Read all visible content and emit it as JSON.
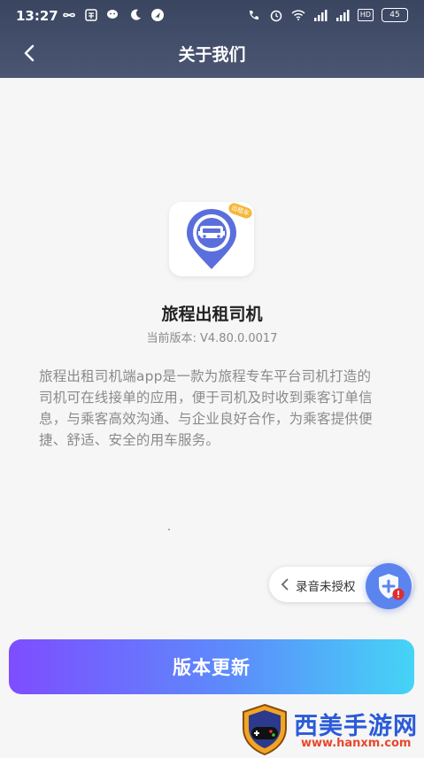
{
  "status_bar": {
    "time": "13:27",
    "battery": "45",
    "hd_badge": "HD",
    "network_label": "4G"
  },
  "nav": {
    "title": "关于我们"
  },
  "app": {
    "tag": "出租车",
    "name": "旅程出租司机",
    "version": "当前版本: V4.80.0.0017",
    "description": "旅程出租司机端app是一款为旅程专车平台司机打造的司机可在线接单的应用，便于司机及时收到乘客订单信息，与乘客高效沟通、与企业良好合作，为乘客提供便捷、舒适、安全的用车服务。"
  },
  "permission": {
    "label": "录音未授权"
  },
  "update_button": {
    "label": "版本更新"
  },
  "watermark": {
    "title": "西美手游网",
    "url": "www.hanxm.com"
  },
  "colors": {
    "header_bg": "#3a4560",
    "accent_gradient_start": "#7e4dff",
    "accent_gradient_end": "#45d4f6",
    "icon_blue": "#5b6fdc"
  }
}
